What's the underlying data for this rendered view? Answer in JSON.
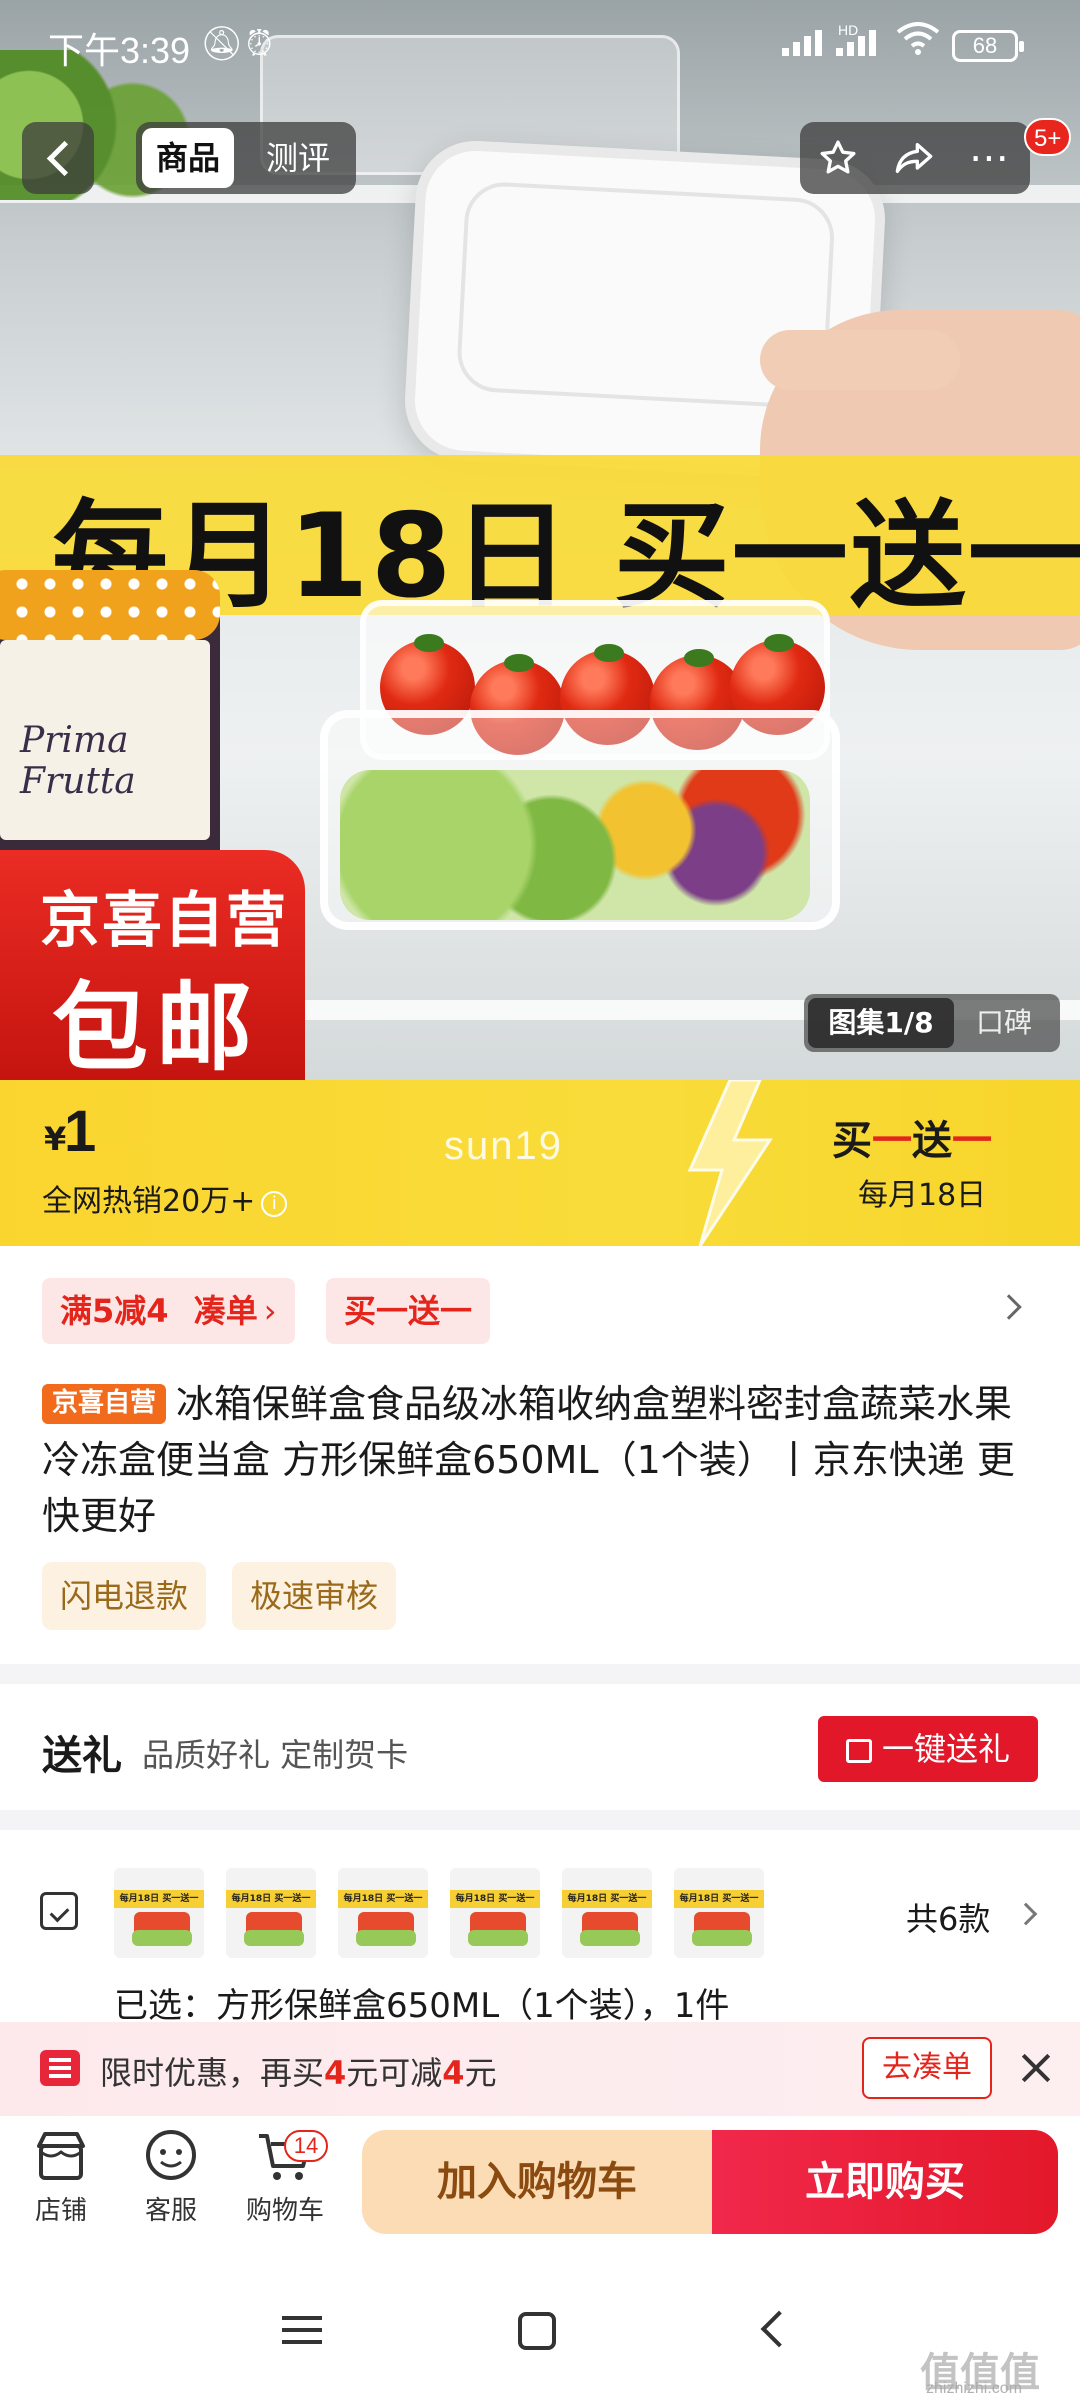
{
  "status_bar": {
    "time": "下午3:39",
    "battery": "68",
    "network": "HD"
  },
  "top_nav": {
    "tabs": [
      "商品",
      "测评"
    ],
    "notification_badge": "5+"
  },
  "hero": {
    "banner": "每月18日 买一送一",
    "badge_line1": "京喜自营",
    "badge_line2": "包邮",
    "jar_brand": "Prima Frutta",
    "gallery": "图集1/8",
    "reviews_tab": "口碑"
  },
  "price_bar": {
    "currency": "¥",
    "price": "1",
    "hot_sales": "全网热销20万+",
    "watermark": "sun19",
    "bogo_a": "买",
    "bogo_b": "一",
    "bogo_c": "送",
    "bogo_d": "一",
    "bogo_date": "每月18日"
  },
  "promo_tags": {
    "discount": "满5减4",
    "bundle": "凑单",
    "bogo": "买一送一"
  },
  "product": {
    "seller_tag": "京喜自营",
    "title": "冰箱保鲜盒食品级冰箱收纳盒塑料密封盒蔬菜水果冷冻盒便当盒 方形保鲜盒650ML（1个装）丨京东快递 更快更好",
    "services": [
      "闪电退款",
      "极速审核"
    ]
  },
  "gift": {
    "title": "送礼",
    "subtitle": "品质好礼 定制贺卡",
    "button": "一键送礼"
  },
  "variants": {
    "thumb_text": "每月18日 买一送一",
    "count": "共6款",
    "selected": "已选：方形保鲜盒650ML（1个装），1件"
  },
  "offer": {
    "prefix": "限时优惠，再买",
    "amount1": "4",
    "mid": "元可减",
    "amount2": "4",
    "suffix": "元",
    "button": "去凑单"
  },
  "bottom_bar": {
    "store": "店铺",
    "service": "客服",
    "cart": "购物车",
    "cart_count": "14",
    "add_to_cart": "加入购物车",
    "buy_now": "立即购买"
  },
  "watermark_site": {
    "mark": "值值值",
    "url": "zhizhizhi.com"
  },
  "colors": {
    "accent_red": "#e3251c",
    "banner_yellow": "#fbd52f",
    "buy_button": "#e3182a"
  }
}
